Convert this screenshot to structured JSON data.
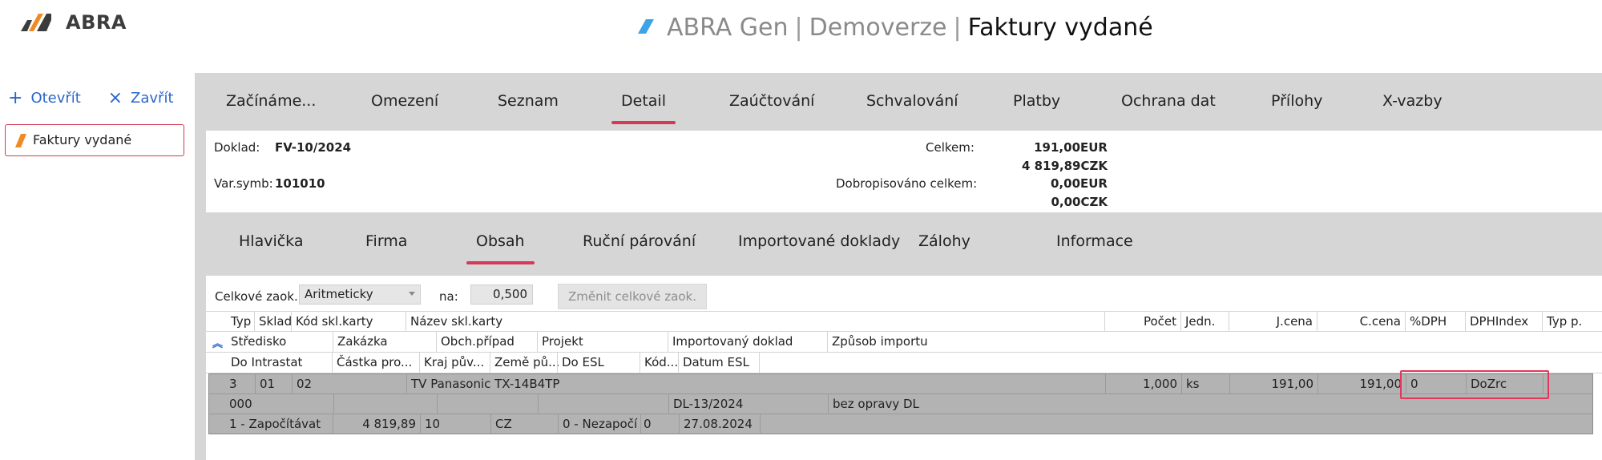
{
  "brand": {
    "logo_text": "ABRA"
  },
  "title": {
    "product": "ABRA Gen",
    "separator": "|",
    "edition": "Demoverze",
    "separator2": "|",
    "agenda": "Faktury vydané"
  },
  "left": {
    "open_label": "Otevřít",
    "close_label": "Zavřít",
    "doc_item_label": "Faktury vydané"
  },
  "main_tabs": [
    "Začínáme...",
    "Omezení",
    "Seznam",
    "Detail",
    "Zaúčtování",
    "Schvalování",
    "Platby",
    "Ochrana dat",
    "Přílohy",
    "X-vazby"
  ],
  "summary": {
    "doklad_label": "Doklad:",
    "doklad_value": "FV-10/2024",
    "varsymb_label": "Var.symb:",
    "varsymb_value": "101010",
    "celkem_label": "Celkem:",
    "celkem_eur": "191,00EUR",
    "celkem_czk": "4 819,89CZK",
    "dobrop_label": "Dobropisováno celkem:",
    "dobrop_eur": "0,00EUR",
    "dobrop_czk": "0,00CZK"
  },
  "sub_tabs": [
    "Hlavička",
    "Firma",
    "Obsah",
    "Ruční párování",
    "Importované doklady",
    "Zálohy",
    "Informace"
  ],
  "rounding": {
    "label": "Celkové zaok.:",
    "method": "Aritmeticky",
    "na_label": "na:",
    "value": "0,500",
    "button": "Změnit celkové zaok."
  },
  "columns": {
    "row1": [
      "Typ",
      "Sklad",
      "Kód skl.karty",
      "Název skl.karty",
      "Počet",
      "Jedn.",
      "J.cena",
      "C.cena",
      "%DPH",
      "DPHIndex",
      "Typ p."
    ],
    "row2": [
      "Středisko",
      "Zakázka",
      "Obch.případ",
      "Projekt",
      "Importovaný doklad",
      "Způsob importu"
    ],
    "row3": [
      "Do Intrastat",
      "Částka pro...",
      "Kraj pův...",
      "Země pů...",
      "Do ESL",
      "Kód...",
      "Datum ESL"
    ]
  },
  "row": {
    "line1": [
      "3",
      "01",
      "02",
      "TV Panasonic TX-14B4TP",
      "1,000",
      "ks",
      "191,00",
      "191,00",
      "0",
      "DoZrc"
    ],
    "line2": [
      "000",
      "DL-13/2024",
      "bez opravy DL"
    ],
    "line3": [
      "1 - Započítávat",
      "4 819,89",
      "10",
      "CZ",
      "0 - Nezapočí",
      "0",
      "27.08.2024"
    ]
  },
  "colors": {
    "accent": "#d23a55",
    "link": "#2a66c8",
    "logo_orange": "#f08a24",
    "logo_blue": "#3da3e8"
  },
  "icons": [
    "plus-icon",
    "close-icon",
    "slash-logo-icon",
    "chevron-up-icon"
  ]
}
